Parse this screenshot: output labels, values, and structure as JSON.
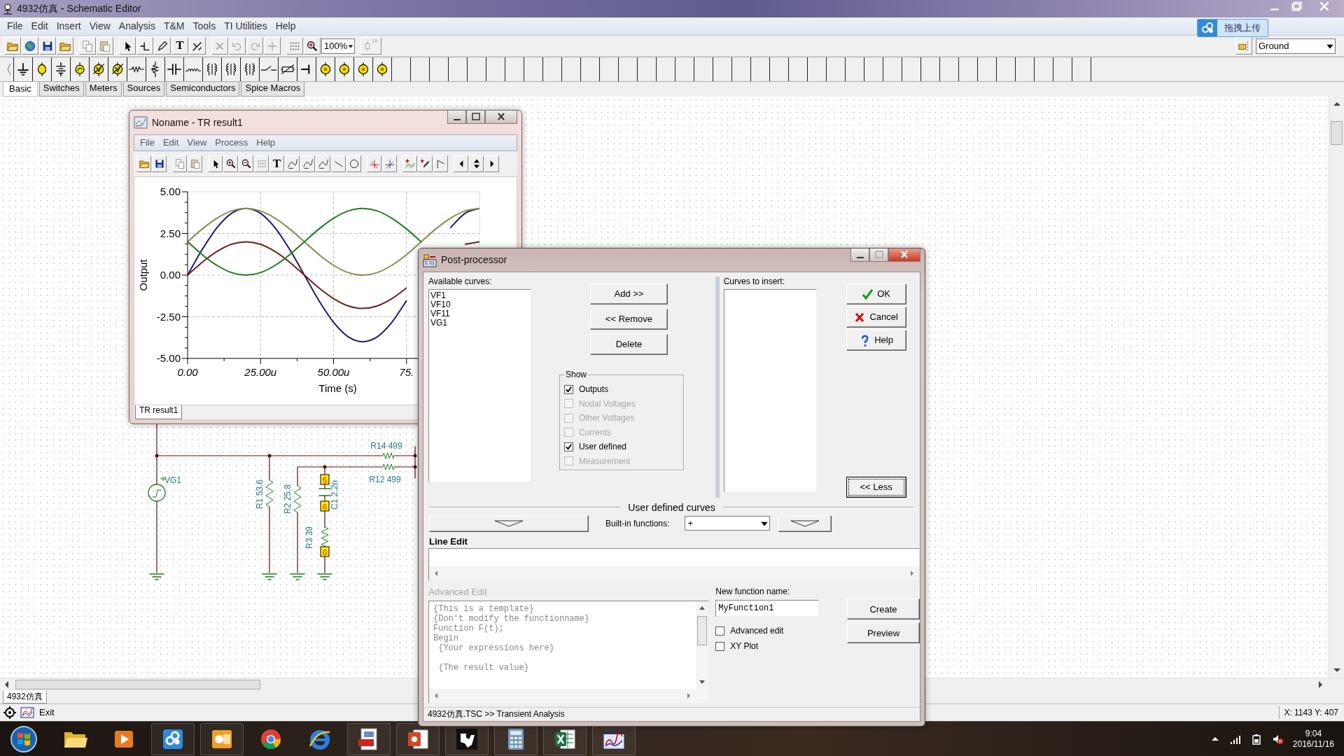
{
  "window": {
    "title": "4932仿真 - Schematic Editor"
  },
  "menu": [
    "File",
    "Edit",
    "Insert",
    "View",
    "Analysis",
    "T&M",
    "Tools",
    "TI Utilities",
    "Help"
  ],
  "upload_button": "拖拽上传",
  "toolbar": {
    "text_tool": "T",
    "zoom": "100%",
    "part_value": "1K",
    "component": "Ground"
  },
  "component_tabs": [
    {
      "label": "Basic",
      "selected": true
    },
    {
      "label": "Switches",
      "selected": false
    },
    {
      "label": "Meters",
      "selected": false
    },
    {
      "label": "Sources",
      "selected": false
    },
    {
      "label": "Semiconductors",
      "selected": false
    },
    {
      "label": "Spice Macros",
      "selected": false
    }
  ],
  "graph_window": {
    "title": "Noname - TR result1",
    "menu": [
      "File",
      "Edit",
      "View",
      "Process",
      "Help"
    ],
    "text_tool": "T",
    "chart_data": {
      "type": "line",
      "grid": true,
      "xlabel": "Time (s)",
      "ylabel": "Output",
      "x": [
        0,
        5,
        10,
        15,
        20,
        25,
        30,
        35,
        40,
        45,
        50,
        55,
        60,
        65,
        70,
        75,
        80,
        85,
        90,
        95,
        100
      ],
      "xlim": [
        0,
        100
      ],
      "ylim": [
        -5,
        5
      ],
      "xticks": [
        {
          "value": 0,
          "label": "0.00"
        },
        {
          "value": 25,
          "label": "25.00u"
        },
        {
          "value": 50,
          "label": "50.00u"
        },
        {
          "value": 75,
          "label": "75."
        }
      ],
      "yticks": [
        {
          "value": 5,
          "label": "5.00"
        },
        {
          "value": 2.5,
          "label": "2.50"
        },
        {
          "value": 0,
          "label": "0.00"
        },
        {
          "value": -2.5,
          "label": "-2.50"
        },
        {
          "value": -5,
          "label": "-5.00"
        }
      ],
      "series": [
        {
          "color": "#1b1b6b",
          "values": [
            0,
            1.53,
            2.83,
            3.7,
            4,
            3.7,
            2.83,
            1.53,
            0,
            -1.53,
            -2.83,
            -3.7,
            -4,
            -3.7,
            -2.83,
            -1.53,
            null,
            null,
            2.83,
            3.7,
            4
          ]
        },
        {
          "color": "#6b1f1f",
          "values": [
            0,
            0.77,
            1.41,
            1.85,
            2,
            1.85,
            1.41,
            0.77,
            0,
            -0.77,
            -1.41,
            -1.85,
            -2,
            -1.85,
            -1.41,
            -0.77,
            null,
            null,
            null,
            1.85,
            2
          ]
        },
        {
          "color": "#8c8a4e",
          "values": [
            2,
            2.77,
            3.41,
            3.85,
            4,
            3.85,
            3.41,
            2.77,
            2,
            1.23,
            0.59,
            0.15,
            0,
            0.15,
            0.59,
            1.23,
            2,
            2.77,
            3.41,
            3.85,
            4
          ]
        },
        {
          "color": "#1f7a1f",
          "values": [
            2,
            1.23,
            0.59,
            0.15,
            0,
            0.15,
            0.59,
            1.23,
            2,
            2.77,
            3.41,
            3.85,
            4,
            3.85,
            3.41,
            2.77,
            2,
            null,
            null,
            null,
            null
          ]
        }
      ]
    },
    "tabs": [
      {
        "label": "TR result1",
        "selected": true
      }
    ]
  },
  "schematic": {
    "labels": [
      "R14 499",
      "R12 499",
      "VG1",
      "R1 53.6",
      "R2 25.8",
      "C1 2.2n",
      "R3 39"
    ],
    "nodes": [
      "5",
      "6",
      "0"
    ]
  },
  "post_processor": {
    "title": "Post-processor",
    "available_label": "Available curves:",
    "available_curves": [
      "VF1",
      "VF10",
      "VF11",
      "VG1"
    ],
    "buttons": [
      "Add >>",
      "<< Remove",
      "Delete"
    ],
    "show_label": "Show",
    "show": [
      {
        "label": "Outputs",
        "checked": true,
        "disabled": false
      },
      {
        "label": "Nodal Voltages",
        "checked": false,
        "disabled": true
      },
      {
        "label": "Other Voltages",
        "checked": false,
        "disabled": true
      },
      {
        "label": "Currents",
        "checked": false,
        "disabled": true
      },
      {
        "label": "User defined",
        "checked": true,
        "disabled": false
      },
      {
        "label": "Measurement",
        "checked": false,
        "disabled": true
      }
    ],
    "insert_label": "Curves to insert:",
    "actions": [
      {
        "kind": "ok",
        "label": "OK"
      },
      {
        "kind": "cancel",
        "label": "Cancel"
      },
      {
        "kind": "help",
        "label": "Help"
      }
    ],
    "less_button": "<< Less",
    "user_defined_heading": "User defined curves",
    "builtin_label": "Built-in functions:",
    "builtin_value": "+",
    "line_edit_label": "Line Edit",
    "advanced_edit": {
      "label": "Advanced Edit",
      "disabled": true,
      "text": "{This is a template}\n{Don't modify the functionname}\nFunction F(t);\nBegin\n {Your expressions here}\n\n {The result value}"
    },
    "new_function_label": "New function name:",
    "new_function_value": "MyFunction1",
    "options": [
      {
        "label": "Advanced edit",
        "checked": false
      },
      {
        "label": "XY Plot",
        "checked": false
      }
    ],
    "create_button": "Create",
    "preview_button": "Preview",
    "status": "4932仿真.TSC >> Transient Analysis"
  },
  "document_tabs": [
    {
      "label": "4932仿真",
      "selected": true
    }
  ],
  "status_bar": {
    "exit": "Exit",
    "coordinates": "X: 1143 Y: 407"
  },
  "taskbar": {
    "time": "9:04",
    "date": "2016/11/16"
  }
}
